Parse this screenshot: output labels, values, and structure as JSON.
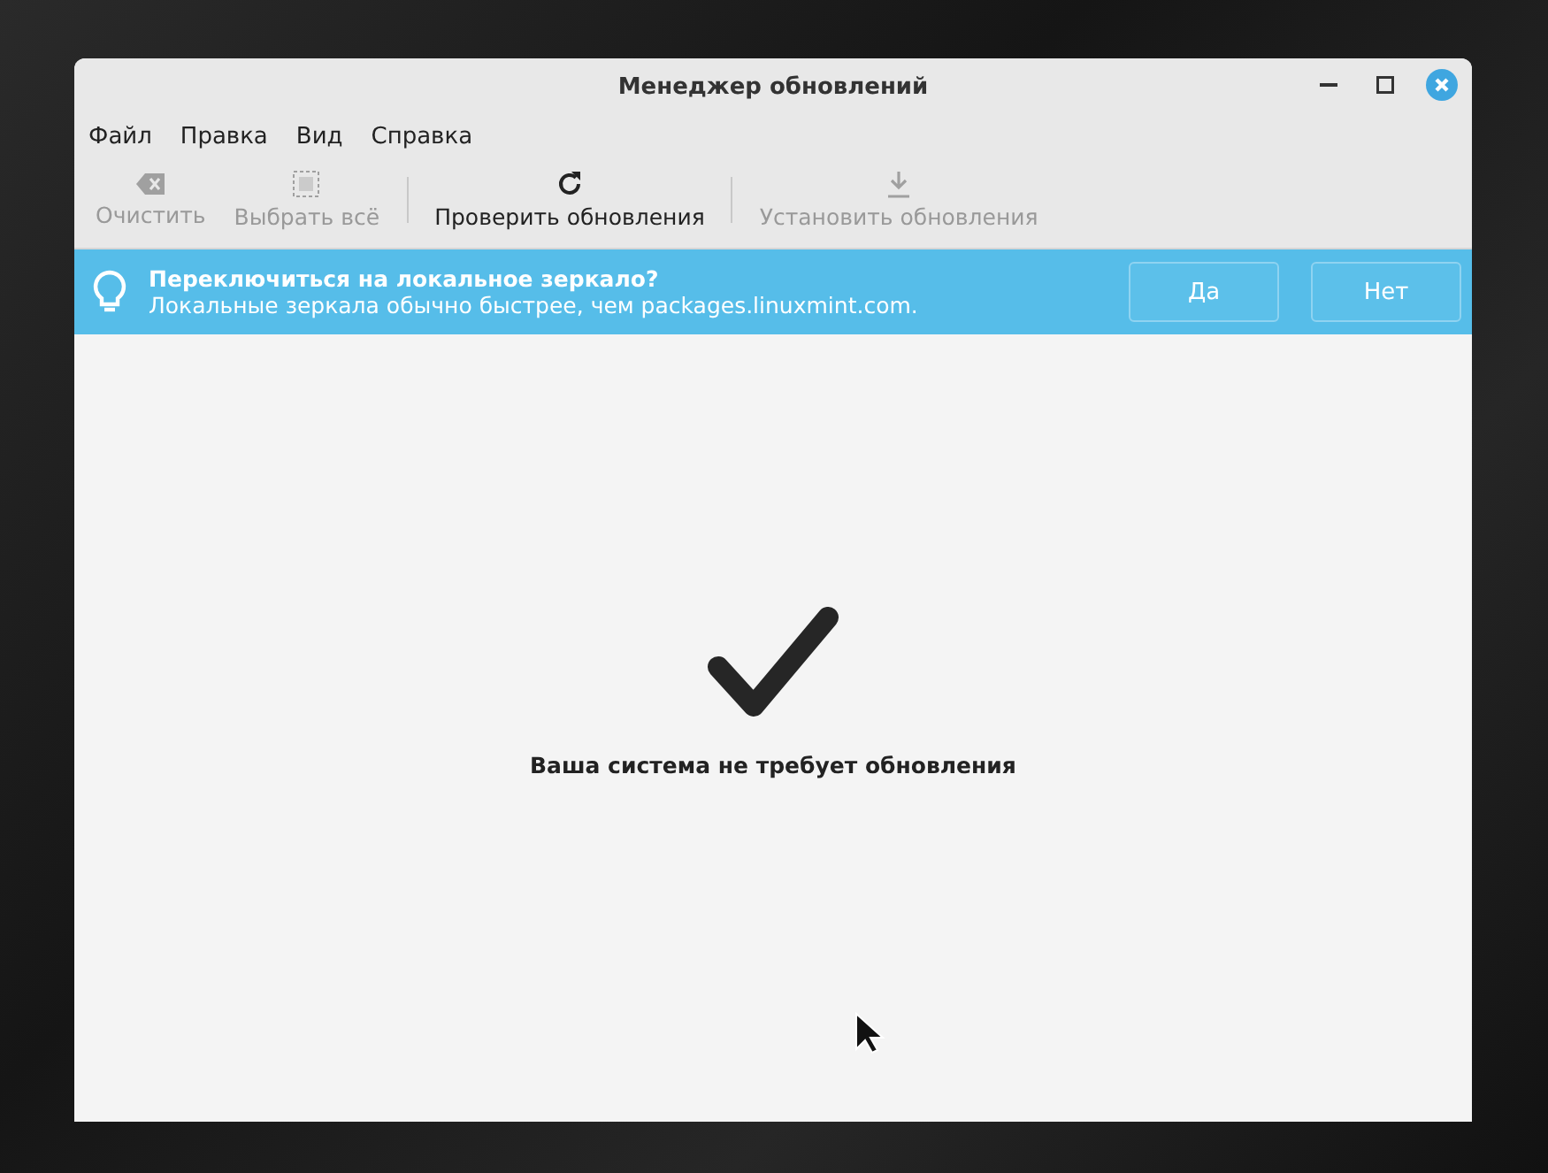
{
  "window": {
    "title": "Менеджер обновлений"
  },
  "menu": [
    "Файл",
    "Правка",
    "Вид",
    "Справка"
  ],
  "toolbar": [
    {
      "kind": "clear",
      "label": "Очистить",
      "disabled": true,
      "separator_before": false
    },
    {
      "kind": "select",
      "label": "Выбрать всё",
      "disabled": true,
      "separator_before": false
    },
    {
      "kind": "refresh",
      "label": "Проверить обновления",
      "disabled": false,
      "separator_before": true
    },
    {
      "kind": "install",
      "label": "Установить обновления",
      "disabled": true,
      "separator_before": true
    }
  ],
  "infobar": {
    "title": "Переключиться на локальное зеркало?",
    "message": "Локальные зеркала обычно быстрее, чем packages.linuxmint.com.",
    "buttons": [
      "Да",
      "Нет"
    ]
  },
  "status": {
    "message": "Ваша система не требует обновления"
  }
}
